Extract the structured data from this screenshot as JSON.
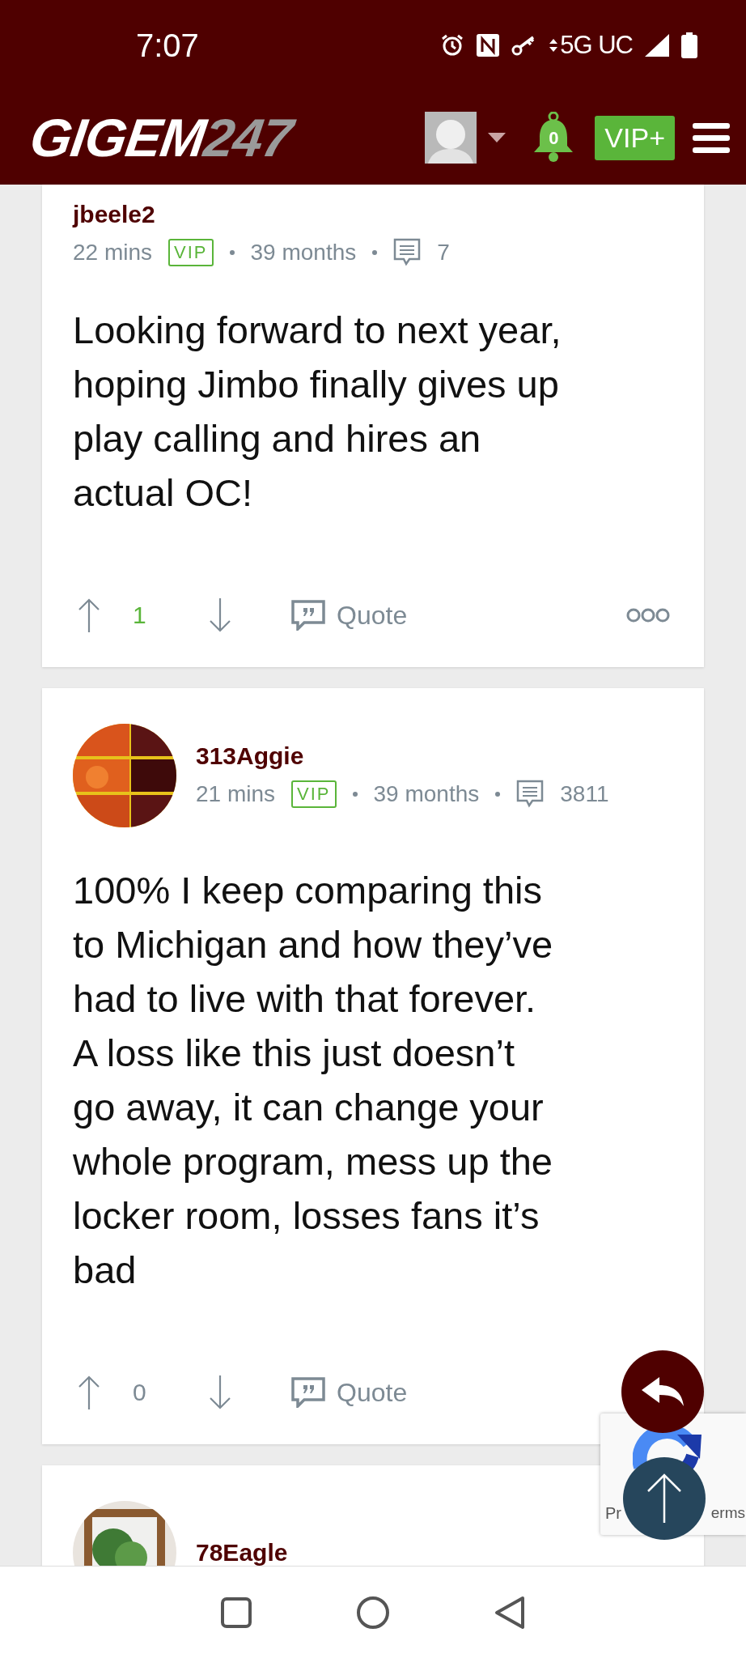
{
  "status_bar": {
    "time": "7:07",
    "network": "5G UC"
  },
  "header": {
    "logo": {
      "main": "GIGEM",
      "accent": "247"
    },
    "notifications": "0",
    "vip_button": "VIP+"
  },
  "posts": [
    {
      "username": "jbeele2",
      "avatar": false,
      "time": "22 mins",
      "badge": "VIP",
      "tenure": "39 months",
      "post_count": "7",
      "body": "Looking forward to next year,\nhoping Jimbo finally gives up\nplay calling and hires an\nactual OC!",
      "score": "1",
      "positive": true,
      "quote": "Quote",
      "more_menu": true
    },
    {
      "username": "313Aggie",
      "avatar": true,
      "time": "21 mins",
      "badge": "VIP",
      "tenure": "39 months",
      "post_count": "3811",
      "body": "100% I keep comparing this\nto Michigan and how they’ve\nhad to live with that forever.\nA loss like this just doesn’t\ngo away, it can change your\nwhole program, mess up the\nlocker room, losses fans it’s\nbad",
      "score": "0",
      "positive": false,
      "quote": "Quote",
      "more_menu": false
    },
    {
      "username": "78Eagle",
      "avatar": true
    }
  ],
  "recaptcha": {
    "left_text": "Pr",
    "right_text": "erms"
  }
}
